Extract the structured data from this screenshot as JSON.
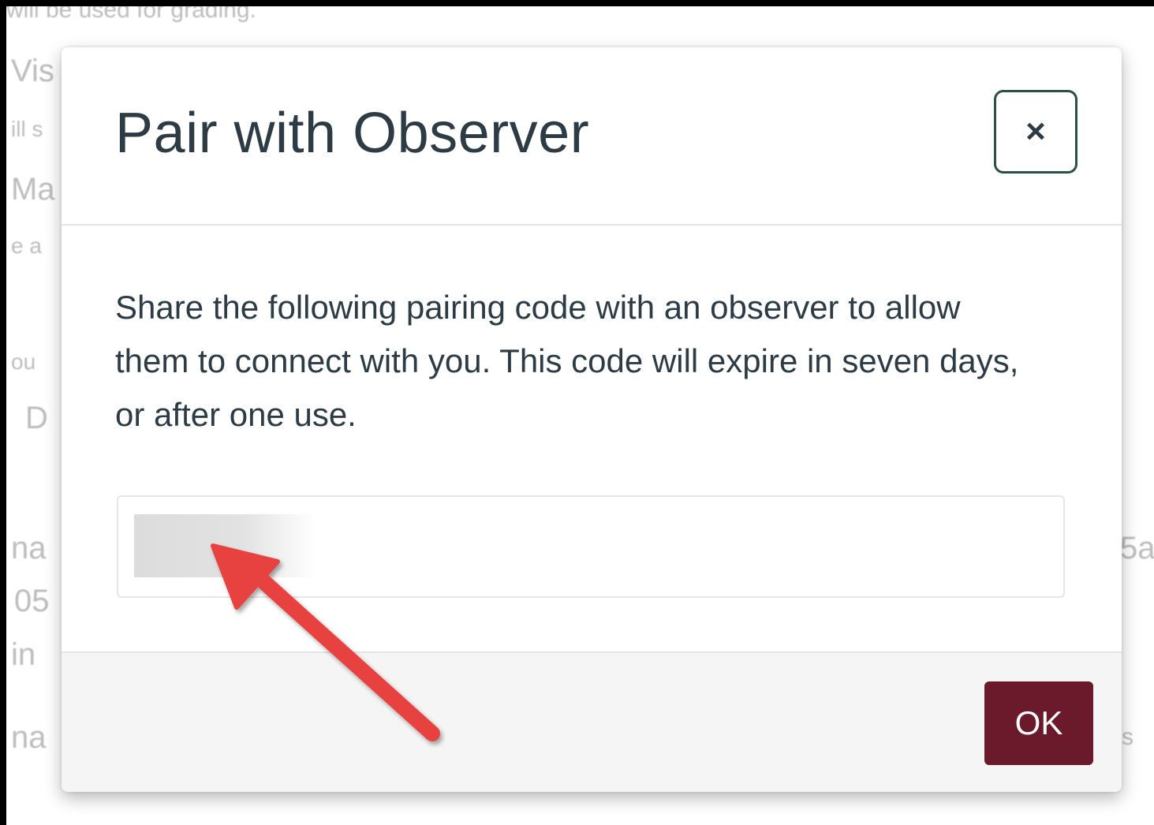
{
  "background": {
    "fragments": [
      "will be used for grading.",
      "Vis",
      "ill s",
      "Ma",
      "e a",
      "ou",
      "D",
      "na",
      "05",
      "in",
      "na",
      "5a",
      "s"
    ]
  },
  "dialog": {
    "title": "Pair with Observer",
    "close_icon": "×",
    "description": "Share the following pairing code with an observer to allow them to connect with you. This code will expire in seven days, or after one use.",
    "pairing_code": "",
    "ok_label": "OK"
  },
  "annotation": {
    "arrow_icon": "red-pointer-arrow",
    "arrow_color": "#e8433f"
  },
  "colors": {
    "ok_button": "#6b1a2c",
    "close_border": "#2a4f45",
    "text": "#2d3b45"
  }
}
